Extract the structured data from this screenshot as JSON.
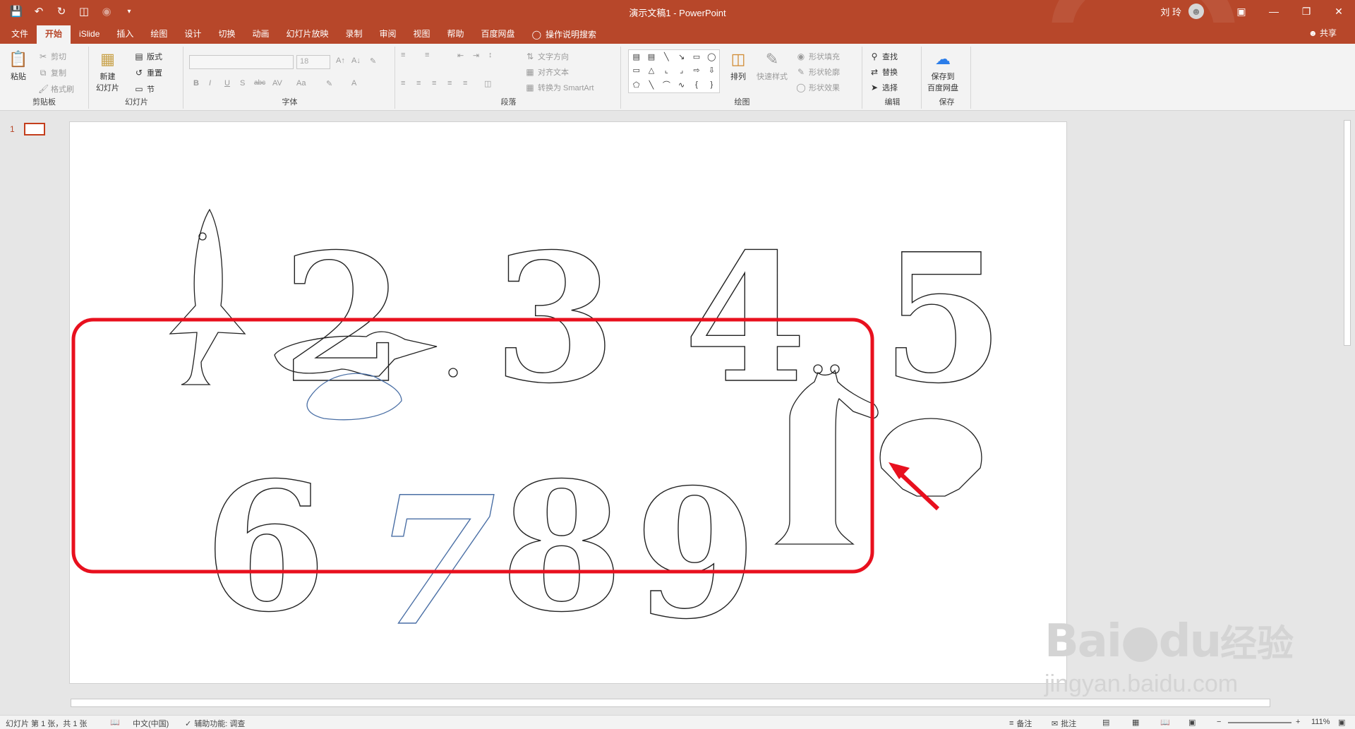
{
  "titlebar": {
    "title": "演示文稿1  -  PowerPoint",
    "user": "刘 玲",
    "window_buttons": [
      "restore-ribbon",
      "minimize",
      "maximize",
      "close"
    ]
  },
  "tabs": {
    "items": [
      "文件",
      "开始",
      "iSlide",
      "插入",
      "绘图",
      "设计",
      "切换",
      "动画",
      "幻灯片放映",
      "录制",
      "审阅",
      "视图",
      "帮助",
      "百度网盘"
    ],
    "active": "开始",
    "tell_me": "操作说明搜索",
    "share": "共享"
  },
  "ribbon": {
    "clipboard": {
      "paste": "粘贴",
      "cut": "剪切",
      "copy": "复制",
      "format_painter": "格式刷",
      "label": "剪贴板"
    },
    "slides": {
      "new_slide": "新建\n幻灯片",
      "layout": "版式",
      "reset": "重置",
      "section": "节",
      "label": "幻灯片"
    },
    "font": {
      "font_size": "18",
      "label": "字体",
      "bold": "B",
      "italic": "I",
      "underline": "U",
      "shadow": "S",
      "strike": "abc",
      "spacing": "AV",
      "case": "Aa",
      "color": "A"
    },
    "paragraph": {
      "text_direction": "文字方向",
      "align_text": "对齐文本",
      "smartart": "转换为 SmartArt",
      "label": "段落"
    },
    "drawing": {
      "arrange": "排列",
      "quick_styles": "快速样式",
      "shape_fill": "形状填充",
      "shape_outline": "形状轮廓",
      "shape_effects": "形状效果",
      "label": "绘图"
    },
    "editing": {
      "find": "查找",
      "replace": "替换",
      "select": "选择",
      "label": "编辑"
    },
    "save": {
      "save_to": "保存到\n百度网盘",
      "label": "保存"
    }
  },
  "thumbnails": {
    "slide_number": "1"
  },
  "statusbar": {
    "slide_info": "幻灯片 第 1 张，共 1 张",
    "language": "中文(中国)",
    "accessibility": "辅助功能: 调查",
    "notes": "备注",
    "comments": "批注",
    "zoom": "111%"
  },
  "slide": {
    "digits_row1": [
      "2",
      "3",
      "4",
      "5"
    ],
    "digits_row2": [
      "6",
      "7",
      "8",
      "9"
    ]
  },
  "watermark": {
    "brand": "Bai",
    "brand2": "du",
    "cn": "经验",
    "url": "jingyan.baidu.com"
  },
  "colors": {
    "accent": "#b7472a",
    "highlight_box": "#e8101e",
    "arrow": "#e8101e",
    "selected_outline": "#4a6fa5"
  }
}
